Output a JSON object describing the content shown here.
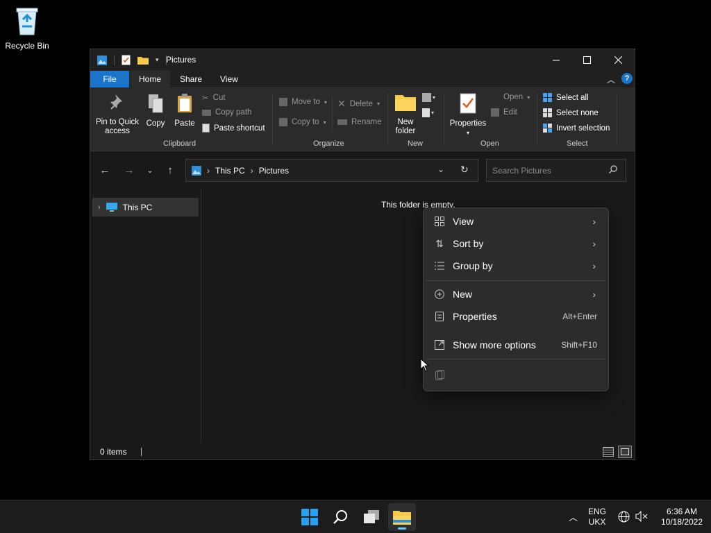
{
  "desktop": {
    "recycle_bin_label": "Recycle Bin"
  },
  "window": {
    "title": "Pictures",
    "tabs": [
      "File",
      "Home",
      "Share",
      "View"
    ],
    "ribbon": {
      "clipboard": {
        "pin_label_1": "Pin to Quick",
        "pin_label_2": "access",
        "copy": "Copy",
        "paste": "Paste",
        "cut": "Cut",
        "copy_path": "Copy path",
        "paste_shortcut": "Paste shortcut",
        "group": "Clipboard"
      },
      "organize": {
        "move_to": "Move to",
        "copy_to": "Copy to",
        "delete": "Delete",
        "rename": "Rename",
        "group": "Organize"
      },
      "new": {
        "new_folder_1": "New",
        "new_folder_2": "folder",
        "group": "New"
      },
      "open": {
        "properties": "Properties",
        "open": "Open",
        "edit": "Edit",
        "group": "Open"
      },
      "select": {
        "select_all": "Select all",
        "select_none": "Select none",
        "invert": "Invert selection",
        "group": "Select"
      }
    },
    "address": {
      "crumb_1": "This PC",
      "crumb_2": "Pictures"
    },
    "search": {
      "placeholder": "Search Pictures"
    },
    "nav_pane": {
      "this_pc": "This PC"
    },
    "empty_message": "This folder is empty.",
    "status": {
      "items": "0 items"
    }
  },
  "context_menu": {
    "view": "View",
    "sort_by": "Sort by",
    "group_by": "Group by",
    "new": "New",
    "properties": "Properties",
    "properties_shortcut": "Alt+Enter",
    "show_more": "Show more options",
    "show_more_shortcut": "Shift+F10"
  },
  "taskbar": {
    "lang_1": "ENG",
    "lang_2": "UKX",
    "time": "6:36 AM",
    "date": "10/18/2022"
  },
  "colors": {
    "accent": "#1a74c9",
    "active_indicator": "#60cdff",
    "folder": "#f7c948"
  }
}
